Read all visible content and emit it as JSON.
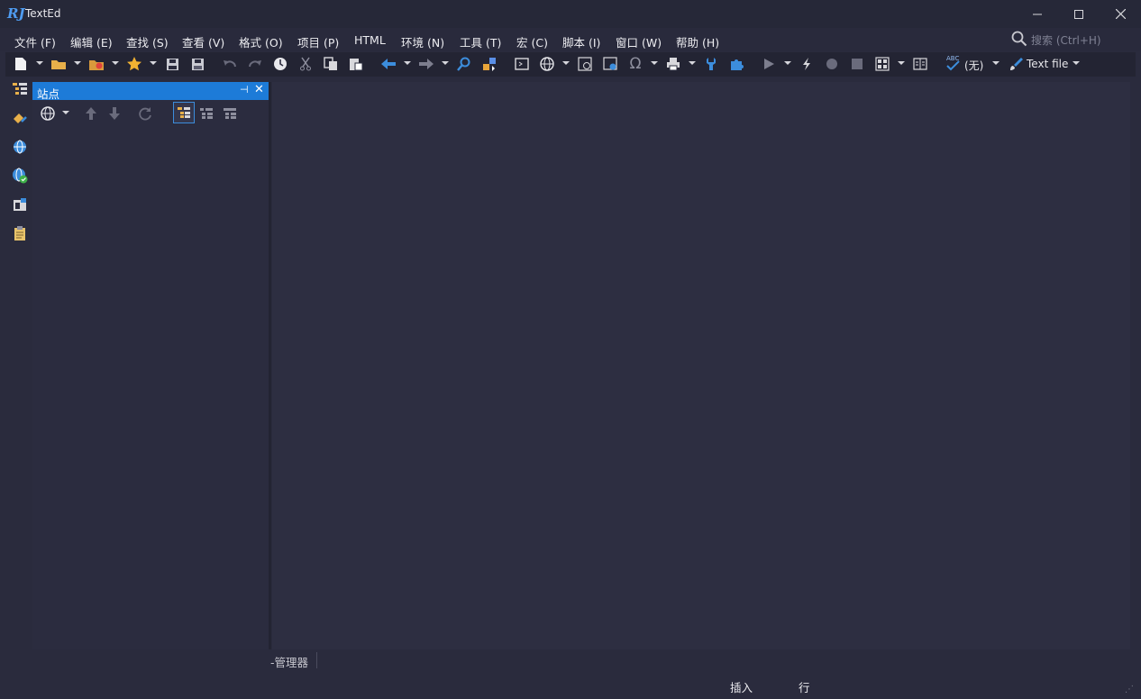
{
  "window": {
    "title": "TextEd",
    "logo_text": "RJ",
    "controls": [
      "minimize-icon",
      "maximize-icon",
      "close-icon"
    ]
  },
  "menu": {
    "items": [
      "文件 (F)",
      "编辑 (E)",
      "查找 (S)",
      "查看 (V)",
      "格式 (O)",
      "项目 (P)",
      "HTML",
      "环境 (N)",
      "工具 (T)",
      "宏 (C)",
      "脚本 (I)",
      "窗口 (W)",
      "帮助 (H)"
    ]
  },
  "search": {
    "placeholder": "搜索 (Ctrl+H)"
  },
  "toolbar": {
    "spell_label": "(无)",
    "spell_icon_text": "ABC",
    "filetype_label": "Text file"
  },
  "side_strip": {
    "icons": [
      "tree-view-icon",
      "clip-tool-icon",
      "globe-icon",
      "globe-check-icon",
      "window-icon",
      "clipboard-icon"
    ]
  },
  "site_panel": {
    "title": "站点",
    "pin_symbol": "⊣",
    "close_symbol": "✕"
  },
  "bottom": {
    "tab_label": "-管理器"
  },
  "status": {
    "insert_mode": "插入",
    "line_label": "行"
  },
  "colors": {
    "accent": "#1d7bd8",
    "background": "#2a2b3d",
    "editor": "#2d2e41",
    "toolbar": "#232433"
  }
}
